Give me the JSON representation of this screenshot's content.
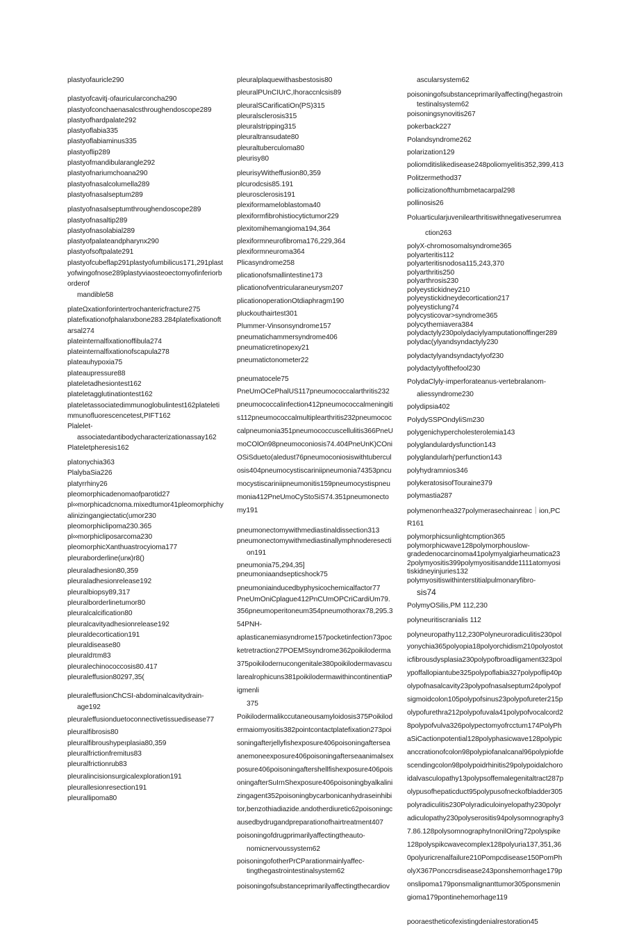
{
  "page": {
    "columns": [
      {
        "lines": [
          {
            "text": "plastyofauricle290"
          },
          {
            "text": "plastyofcavitj·ofauricularconcha290",
            "gap": "l"
          },
          {
            "text": "plastyofconchaenasalcsthroughendoscope289"
          },
          {
            "text": "plastyofhardpalate292"
          },
          {
            "text": "plastyoflabia335"
          },
          {
            "text": "plastyoflabiaminus335"
          },
          {
            "text": "plastyoflip289"
          },
          {
            "text": "plastyofmandibularangle292"
          },
          {
            "text": "plastyofnariumchoana290"
          },
          {
            "text": "plastyofnasalcolumella289"
          },
          {
            "text": "plastyofnasalseptum289"
          },
          {
            "text": "plastyofnasalseptumthroughendoscope289",
            "gap": "m"
          },
          {
            "text": "plastyofnasaltip289"
          },
          {
            "text": "plastyofnasolabial289"
          },
          {
            "text": "plastyofpalateandpharynx290"
          },
          {
            "text": "plastyofsoftpalate291"
          },
          {
            "text": "plastyofcubeflap291plastyofumbilicus171,291plast"
          },
          {
            "text": "yofwingofnose289plastyviaosteoectomyofinferiorb"
          },
          {
            "text": "orderof"
          },
          {
            "text": "mandible58",
            "indent": 1
          },
          {
            "text": "plateΩxationforintertrochantericfracture275",
            "gap": "m"
          },
          {
            "text": "platefixationofphalanxbone283.284platefixationoft"
          },
          {
            "text": "arsal274"
          },
          {
            "text": "plateinternalfixationoffibula274"
          },
          {
            "text": "plateinternalfixationofscapula278"
          },
          {
            "text": "plateauhypoxia75"
          },
          {
            "text": "plateaupressure88"
          },
          {
            "text": "plateletadhesiontest162"
          },
          {
            "text": "plateletagglutinationtest162"
          },
          {
            "text": "plateletassociatedimmunoglobulintest162plateleti"
          },
          {
            "text": "mmunofluorescencetest,PIFT162"
          },
          {
            "text": "Plalelet-"
          },
          {
            "text": "associatedantibodycharacterizationassay162",
            "indent": 1
          },
          {
            "text": "Plateletpheresis162"
          },
          {
            "text": "platonychia363",
            "gap": "m"
          },
          {
            "text": "PlalybaSia226"
          },
          {
            "text": "platyrrhiny26"
          },
          {
            "text": "pleomorphicadenomaofparotid27"
          },
          {
            "text": "pl∞morphicadcnoma.mixedtumor41pleomorphichy"
          },
          {
            "text": "alinizingangiectatic(umor230"
          },
          {
            "text": "pleomorphiclipoma230.365"
          },
          {
            "text": "pl∞morphicliposarcoma230"
          },
          {
            "text": "pleomorphicXanthuastrocyioma177"
          },
          {
            "text": "pleuraborderline(unк)r8()"
          },
          {
            "text": "pleuraladhesion80,359",
            "gap": "s"
          },
          {
            "text": "pleuraladhesionrelease192"
          },
          {
            "text": "pleuralbiopsy89,317"
          },
          {
            "text": "pleuralborderlinetumor80"
          },
          {
            "text": "pleuralcalcification80"
          },
          {
            "text": "pleuralcavityadhesionrelease192"
          },
          {
            "text": "pleuraldecortication191"
          },
          {
            "text": "pleuraldisease80"
          },
          {
            "text": "pleuraldπm83"
          },
          {
            "text": "pleuralechinococcosis80.417"
          },
          {
            "text": "pleuraleffusion80297,35("
          },
          {
            "text": "pleuraleffusionChCSI-abdominalcavitydrain-",
            "gap": "l"
          },
          {
            "text": "age192",
            "indent": 1
          },
          {
            "text": "pleuraleffusionduetoconnectivetissuedisease77",
            "gap": "s"
          },
          {
            "text": "pleuralfibrosis80",
            "gap": "s"
          },
          {
            "text": "pleuralfibroushypeıplasia80,359"
          },
          {
            "text": "pleuralfrictionfremitus83"
          },
          {
            "text": "pleuralfrictionrub83"
          },
          {
            "text": "pleuralincisionsurgicalexploration191",
            "gap": "s"
          },
          {
            "text": "pleurallesionresection191"
          },
          {
            "text": "pleurallipoma80"
          }
        ]
      },
      {
        "lines": [
          {
            "text": "pleuralplaquewithasbestosis80"
          },
          {
            "text": "pleuralPUnCIUrC,Ihoraccnlcsis89",
            "gap": "s"
          },
          {
            "text": "pleuralSCarificatiOn(PS)315",
            "gap": "s"
          },
          {
            "text": "pleuralsclerosis315"
          },
          {
            "text": "pleuralstripping315"
          },
          {
            "text": "pleuraltransudate80"
          },
          {
            "text": "pleuraltuberculoma80"
          },
          {
            "text": "pleurisy80"
          },
          {
            "text": "pleurisyWitheffusion80,359",
            "gap": "m"
          },
          {
            "text": "plcurodcsis85.191"
          },
          {
            "text": "pleurosclerosis191"
          },
          {
            "text": "plexiformameloblastoma40"
          },
          {
            "text": "plexiformfibrohistiocytictumor229"
          },
          {
            "text": "plexitomihemangioma194,364",
            "gap": "s"
          },
          {
            "text": "plexiformneurofibroma176,229,364",
            "gap": "s"
          },
          {
            "text": "plexiformneuroma364"
          },
          {
            "text": "Plicasyndrome258"
          },
          {
            "text": "plicationofsmallintestine173",
            "gap": "s"
          },
          {
            "text": "plicationofventricularaneurysm207",
            "gap": "s"
          },
          {
            "text": "plicationoperationOtdiaphragm190",
            "gap": "s"
          },
          {
            "text": "pluckouthairtest301",
            "gap": "s"
          },
          {
            "text": "Plummer-Vinsonsyndrome157",
            "gap": "s"
          },
          {
            "text": "pneumatichammersyndrome406"
          },
          {
            "text": "pneumaticretinopexy21"
          },
          {
            "text": "pneumatictonometer22",
            "gap": "s"
          },
          {
            "text": "pneumatocele75",
            "gap": "l"
          },
          {
            "text": "PneUmOCePhalUS117pneumococcalarthritis232",
            "loose": true
          },
          {
            "text": "pneumococcalinfection412pneumococcalmeningiti",
            "loose": true
          },
          {
            "text": "s112pneumococcalmultiplearthritis232pneumococ",
            "loose": true
          },
          {
            "text": "calpneumonia351pneumococcuscellulitis366PneU",
            "loose": true
          },
          {
            "text": "moCOlOn98pneumoconiosis74.404PneUnK)COni",
            "loose": true
          },
          {
            "text": "OSiSdueto(aledust76pneumoconiosiswithtubercul",
            "loose": true
          },
          {
            "text": "osis404pneumocystiscariniipneumonia74353pncu",
            "loose": true
          },
          {
            "text": "mocystiscariniipneumonitis159pneumocystispneu",
            "loose": true
          },
          {
            "text": "monia412PneUmoCyStoSiS74.351pneumonecto",
            "loose": true
          },
          {
            "text": "my191",
            "loose": true
          },
          {
            "text": "pneumonectomywithmediastinaldissection313",
            "gap": "l"
          },
          {
            "text": "pneumonectomywithmediastinallymphnoderesecti"
          },
          {
            "text": "on191",
            "indent": 1,
            "loose": true
          },
          {
            "text": "pneumonia75,294,35]",
            "gap": "s",
            "tight": true
          },
          {
            "text": "pneumoniaandsepticshock75",
            "tight": true
          },
          {
            "text": "pneumoniainducedbyphysicochemicalfactor77",
            "gap": "m"
          },
          {
            "text": "PneUmOniCplague412PnCUmOPCriCardiUm79."
          },
          {
            "text": "356pneumoperitoneum354pneumothorax78,295.3",
            "loose": true
          },
          {
            "text": "54PNH-",
            "loose": true
          },
          {
            "text": "aplasticanemiasyndrome157pocketinfection73poc",
            "loose": true
          },
          {
            "text": "ketretraction27POEMSsyndrome362poikiloderma",
            "loose": true
          },
          {
            "text": "375poikilodernucongenitale380poikilodermavascu",
            "loose": true
          },
          {
            "text": "larealrophicuns381poikilodermawithincontinentiaP",
            "loose": true
          },
          {
            "text": "igmenli",
            "loose": true
          },
          {
            "text": "375",
            "indent": 1,
            "loose": true
          },
          {
            "text": "Poikilodermalikccutaneousamyloidosis375Poikilod",
            "loose": true
          },
          {
            "text": "ermaiomyositis382pointcontactplatefixation273poi",
            "loose": true
          },
          {
            "text": "soningafterjellyfishexposure406poisoningaftersea",
            "loose": true
          },
          {
            "text": "anemoneexposure406poisoningafterseaanimalsex",
            "loose": true
          },
          {
            "text": "posure406poisoningaftershellfishexposure406pois",
            "loose": true
          },
          {
            "text": "oningafterSuIrnShexposure406poisoningbyalkalini",
            "loose": true
          },
          {
            "text": "zingagent352poisoningbycarbonicanhydraseinhibi",
            "loose": true
          },
          {
            "text": "tor,benzothiadiazide.andotherdiuretic62poisoningc",
            "loose": true
          },
          {
            "text": "ausedbydrugandpreparationofhairtreatment407",
            "loose": true
          },
          {
            "text": "poisoningofdrugprimarilyaffectingtheauto-",
            "loose": true
          },
          {
            "text": "nomicnervoussystem62",
            "indent": 1,
            "loose": true
          },
          {
            "text": "poisoningofotherPrCParationmainlyaffec-",
            "gap": "s",
            "tight": true
          },
          {
            "text": "tingthegastrointestinalsystem62",
            "indent": 1
          },
          {
            "text": "poisoningofsubstanceprimarilyaffectingthecardiov",
            "gap": "m"
          }
        ]
      },
      {
        "lines": [
          {
            "text": "ascularsystem62",
            "indent": 1
          },
          {
            "text": "poisoningofsubstanceprimarilyaffecting(hegastroin",
            "gap": "m"
          },
          {
            "text": "testinalsystem62",
            "indent": 1,
            "tight": true
          },
          {
            "text": "poisoningsynovitis267"
          },
          {
            "text": "pokerback227",
            "gap": "s"
          },
          {
            "text": "Polandsyndrome262",
            "gap": "s"
          },
          {
            "text": "polarization129",
            "gap": "s"
          },
          {
            "text": "poliomditislikedisease248poliomyelitis352,399,413",
            "gap": "s"
          },
          {
            "text": "Politzermethod37",
            "gap": "s"
          },
          {
            "text": "pollicizationofthumbmetacarpal298",
            "gap": "s"
          },
          {
            "text": "pollinosis26",
            "gap": "s"
          },
          {
            "text": "Poluarticularjuvenilearthritiswithnegativeserumrea",
            "gap": "m"
          },
          {
            "text": "ction263",
            "indent": 2,
            "gap": "m"
          },
          {
            "text": "polyX-chromosomalsyndrome365",
            "gap": "m",
            "tight": true
          },
          {
            "text": "polyarteritis112",
            "tight": true
          },
          {
            "text": "polyarteritisnodosa115,243,370",
            "tight": true
          },
          {
            "text": "polyarthritis250",
            "tight": true
          },
          {
            "text": "polyarthrosis230",
            "tight": true
          },
          {
            "text": "polyeystickidney210",
            "tight": true
          },
          {
            "text": "polyeystickidneydecortication217",
            "tight": true
          },
          {
            "text": "polyeysticlung74",
            "tight": true
          },
          {
            "text": "polycysticovar>syndrome365",
            "tight": true
          },
          {
            "text": "polycythemiavera384",
            "tight": true
          },
          {
            "text": "polydactyly230polydaciylyamputationoffinger289",
            "tight": true
          },
          {
            "text": "polydac(ylyandsyndactyly230",
            "tight": true
          },
          {
            "text": "polydactylyandsyndactylyof230",
            "gap": "m"
          },
          {
            "text": "polydactylyofthefool230",
            "gap": "s"
          },
          {
            "text": "PolydaClyly-imperforateanus-vertebralanom-",
            "gap": "s"
          },
          {
            "text": "aliessyndrome230",
            "indent": 1,
            "gap": "s"
          },
          {
            "text": "polydipsia402",
            "gap": "s"
          },
          {
            "text": "PolydySSPOndyliSm230",
            "gap": "s"
          },
          {
            "text": "polygenichypercholesterolemia143",
            "gap": "s"
          },
          {
            "text": "polyglandulardysfunction143",
            "gap": "s"
          },
          {
            "text": "polyglandularhj'perfunction143",
            "gap": "s"
          },
          {
            "text": "polyhydramnios346",
            "gap": "s"
          },
          {
            "text": "polykeratosisofTouraine379",
            "gap": "s"
          },
          {
            "text": "polymastia287",
            "gap": "s"
          },
          {
            "text": "polymenorrhea327polymerasechainreac｜ion,PC",
            "gap": "m"
          },
          {
            "text": "R161",
            "gap": "s"
          },
          {
            "text": "polymorphicsunlightcmption365",
            "gap": "m",
            "tight": true
          },
          {
            "text": "polymorphicwave128polymorphouslow-",
            "tight": true
          },
          {
            "text": "gradedenocarcinoma41polymyalgiarheumatica23",
            "tight": true
          },
          {
            "text": "2polymyositis399polymyositisandde1111atomyosi",
            "tight": true
          },
          {
            "text": "tiskidneyinjuries132",
            "tight": true
          },
          {
            "text": "polymyositiswithinterstitialpulmonaryfibro-",
            "tight": true
          },
          {
            "text": "sis74",
            "indent": 1,
            "big": true,
            "gap": "s"
          },
          {
            "text": "PolymyOSilis,PM      112,230",
            "gap": "s"
          },
          {
            "text": "polyneuritiscranialis       112",
            "gap": "m"
          },
          {
            "text": "polyneuropathy112,230Polyneuroradiculitis230pol",
            "gap": "m"
          },
          {
            "text": "yonychia365polyopia18polyorchidism210polyostot",
            "loose": true
          },
          {
            "text": "icfibrousdysplasia230polypofbroadligament323pol",
            "loose": true
          },
          {
            "text": "ypoffallopiantube325polypoflabia327polypoflip40p",
            "loose": true
          },
          {
            "text": "olypofnasalcavity23polypofnasalseptum24polypof",
            "loose": true
          },
          {
            "text": "sigmoidcolon105polypofsinus23polypofureter215p",
            "loose": true
          },
          {
            "text": "olypofurethra212polypofuvala41polypofvocalcord2",
            "loose": true
          },
          {
            "text": "8polypofvulva326polypectomyofrcctum174PolyPh",
            "loose": true
          },
          {
            "text": "aSiCactionpotential128polyphasicwave128polypic",
            "loose": true
          },
          {
            "text": "anccrationofcolon98polypiofanalcanal96polypiofde",
            "loose": true
          },
          {
            "text": "scendingcolon98polypoidrhinitis29polypoidalchoro",
            "loose": true
          },
          {
            "text": "idalvasculopathy13polypsoffemalegenitaltract287p",
            "loose": true
          },
          {
            "text": "olypusofhepaticduct95polypusofneckofbladder305",
            "loose": true
          },
          {
            "text": "polyradiculitis230Polyradiculoinyelopathy230polyr",
            "loose": true
          },
          {
            "text": "adiculopathy230polyserositis94polysomnography3",
            "loose": true
          },
          {
            "text": "7.86.128polysomnographyInonilOring72polyspike",
            "loose": true
          },
          {
            "text": "128polyspikcwavecomplex128polyuria137,351,36",
            "loose": true
          },
          {
            "text": "0polyuricrenalfailure210Pompcdisease150PomPh",
            "loose": true
          },
          {
            "text": "olyX367Ponccrsdisease243ponshemorrhage179p",
            "loose": true
          },
          {
            "text": "onslipoma179ponsmalignanttumor305ponsmenin",
            "loose": true
          },
          {
            "text": "gioma179pontinehemorhage119",
            "loose": true
          },
          {
            "text": "pooraestheticofexistingdenialrestoration45",
            "gap": "xl"
          }
        ]
      }
    ]
  }
}
